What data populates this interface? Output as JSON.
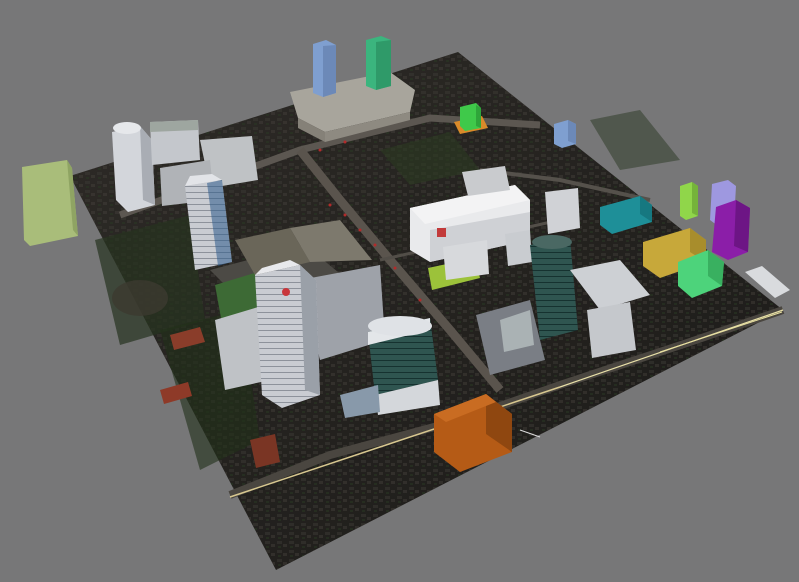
{
  "viewport": {
    "background": "#777778",
    "ground_color": "#24221f",
    "road_color": "#6b6660",
    "block_colors": {
      "light_green": "#a9bd7a",
      "blue": "#7f9fd0",
      "teal_green": "#3bb57e",
      "green": "#3fc94a",
      "orange": "#d98a2a",
      "teal": "#1e8f98",
      "yellow": "#c7a83a",
      "bright_green": "#4dd37b",
      "lime": "#90d64a",
      "lavender": "#9e98e0",
      "purple": "#8b1ea8",
      "brown_orange": "#b55b16"
    }
  }
}
